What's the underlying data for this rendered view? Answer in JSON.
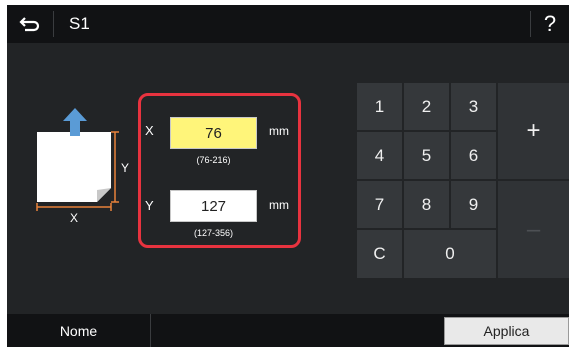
{
  "header": {
    "title": "S1",
    "help_label": "?"
  },
  "diagram": {
    "x_label": "X",
    "y_label": "Y"
  },
  "inputs": {
    "x": {
      "axis": "X",
      "value": "76",
      "unit": "mm",
      "range": "(76-216)"
    },
    "y": {
      "axis": "Y",
      "value": "127",
      "unit": "mm",
      "range": "(127-356)"
    }
  },
  "keypad": {
    "keys": [
      "1",
      "2",
      "3",
      "4",
      "5",
      "6",
      "7",
      "8",
      "9",
      "C",
      "0"
    ],
    "plus": "+",
    "minus": "–"
  },
  "footer": {
    "name_label": "Nome",
    "apply_label": "Applica"
  },
  "colors": {
    "highlight_border": "#e8333f",
    "active_field": "#fff57a",
    "arrow": "#5a9bd6"
  }
}
